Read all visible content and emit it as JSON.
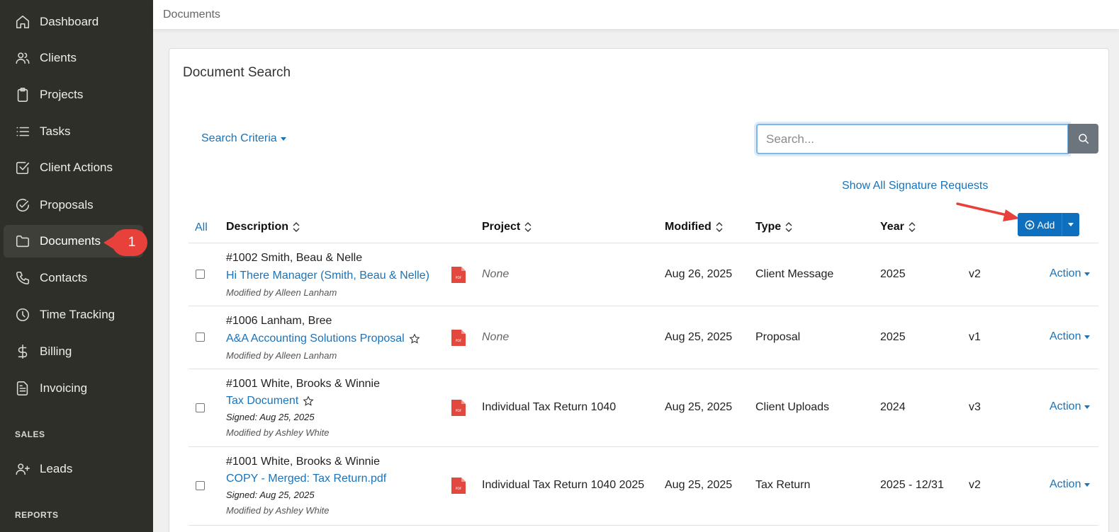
{
  "sidebar": {
    "items": [
      {
        "label": "Dashboard",
        "icon": "home-icon"
      },
      {
        "label": "Clients",
        "icon": "users-icon"
      },
      {
        "label": "Projects",
        "icon": "clipboard-icon"
      },
      {
        "label": "Tasks",
        "icon": "list-icon"
      },
      {
        "label": "Client Actions",
        "icon": "checkbox-icon"
      },
      {
        "label": "Proposals",
        "icon": "check-circle-icon"
      },
      {
        "label": "Documents",
        "icon": "folder-icon",
        "active": true
      },
      {
        "label": "Contacts",
        "icon": "phone-icon"
      },
      {
        "label": "Time Tracking",
        "icon": "clock-icon"
      },
      {
        "label": "Billing",
        "icon": "dollar-icon"
      },
      {
        "label": "Invoicing",
        "icon": "document-icon"
      }
    ],
    "sales_label": "SALES",
    "sales_items": [
      {
        "label": "Leads",
        "icon": "user-plus-icon"
      }
    ],
    "reports_label": "REPORTS",
    "step_marker": "1"
  },
  "topbar": {
    "breadcrumb": "Documents"
  },
  "card": {
    "title": "Document Search",
    "search_criteria_label": "Search Criteria",
    "search_placeholder": "Search...",
    "search_value": "",
    "signature_link": "Show All Signature Requests",
    "add_label": "Add"
  },
  "table": {
    "all_label": "All",
    "headers": {
      "description": "Description",
      "project": "Project",
      "modified": "Modified",
      "type": "Type",
      "year": "Year"
    },
    "rows": [
      {
        "client": "#1002 Smith, Beau & Nelle",
        "title": "Hi There Manager (Smith, Beau & Nelle)",
        "starred": false,
        "signed": "",
        "modified_by": "Modified by Alleen Lanham",
        "project": "None",
        "modified": "Aug 26, 2025",
        "type": "Client Message",
        "year": "2025",
        "version": "v2",
        "action": "Action"
      },
      {
        "client": "#1006 Lanham, Bree",
        "title": "A&A Accounting Solutions Proposal",
        "starred": true,
        "signed": "",
        "modified_by": "Modified by Alleen Lanham",
        "project": "None",
        "modified": "Aug 25, 2025",
        "type": "Proposal",
        "year": "2025",
        "version": "v1",
        "action": "Action"
      },
      {
        "client": "#1001 White, Brooks & Winnie",
        "title": "Tax Document",
        "starred": true,
        "signed": "Signed: Aug 25, 2025",
        "modified_by": "Modified by Ashley White",
        "project": "Individual Tax Return 1040",
        "modified": "Aug 25, 2025",
        "type": "Client Uploads",
        "year": "2024",
        "version": "v3",
        "action": "Action"
      },
      {
        "client": "#1001 White, Brooks & Winnie",
        "title": "COPY - Merged: Tax Return.pdf",
        "starred": false,
        "signed": "Signed: Aug 25, 2025",
        "modified_by": "Modified by Ashley White",
        "project": "Individual Tax Return 1040 2025",
        "modified": "Aug 25, 2025",
        "type": "Tax Return",
        "year": "2025 - 12/31",
        "version": "v2",
        "action": "Action"
      }
    ]
  },
  "colors": {
    "sidebar_bg": "#2f2f2a",
    "link": "#1a73b8",
    "primary_button": "#0d6fbd",
    "annotation": "#e8403a",
    "pdf_icon": "#e2483d"
  }
}
